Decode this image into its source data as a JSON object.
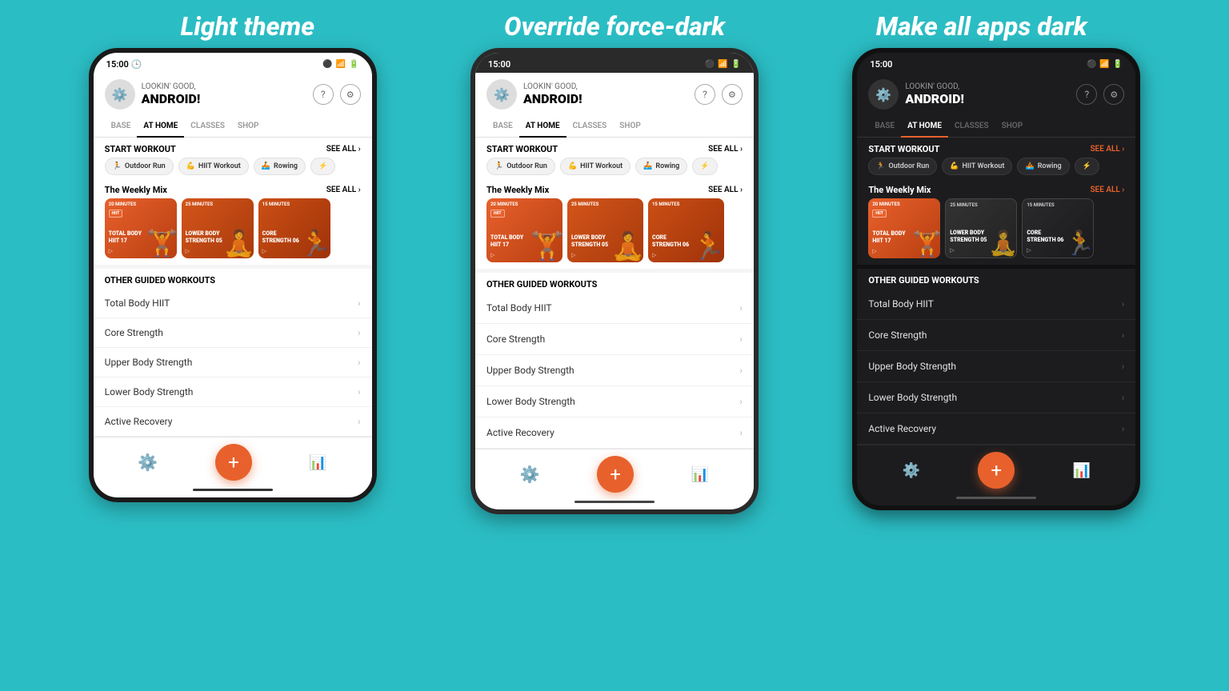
{
  "page": {
    "bg_color": "#2bbdc4",
    "headings": [
      {
        "label": "Light theme",
        "color": "#fff"
      },
      {
        "label": "Override force-dark",
        "color": "#fff"
      },
      {
        "label": "Make all apps dark",
        "color": "#fff"
      }
    ]
  },
  "phones": [
    {
      "theme": "light",
      "status": {
        "time": "15:00",
        "icons": "📶 🔋"
      },
      "greeting": "LOOKIN' GOOD,",
      "name": "ANDROID!",
      "nav": {
        "tabs": [
          "BASE",
          "AT HOME",
          "CLASSES",
          "SHOP"
        ],
        "active": "AT HOME"
      },
      "start_workout": {
        "title": "START WORKOUT",
        "see_all": "SEE ALL",
        "chips": [
          {
            "icon": "🏃",
            "label": "Outdoor Run"
          },
          {
            "icon": "💪",
            "label": "HIIT Workout"
          },
          {
            "icon": "🚣",
            "label": "Rowing"
          }
        ]
      },
      "weekly_mix": {
        "title": "The Weekly Mix",
        "see_all": "SEE ALL",
        "cards": [
          {
            "duration": "20 MINUTES",
            "badge": "HIIT",
            "title": "TOTAL BODY\nHIIT 17",
            "color": "#e8612c"
          },
          {
            "duration": "25 MINUTES",
            "badge": "",
            "title": "LOWER BODY\nSTRENGTH 05",
            "color": "#c44b1e"
          },
          {
            "duration": "15 MINUTES",
            "badge": "",
            "title": "CORE\nSTRENGTH 06",
            "color": "#d4551a"
          }
        ]
      },
      "guided_workouts": {
        "title": "OTHER GUIDED WORKOUTS",
        "items": [
          "Total Body HIIT",
          "Core Strength",
          "Upper Body Strength",
          "Lower Body Strength",
          "Active Recovery"
        ]
      }
    },
    {
      "theme": "dark",
      "status": {
        "time": "15:00",
        "icons": "📶 🔋"
      },
      "greeting": "LOOKIN' GOOD,",
      "name": "ANDROID!",
      "nav": {
        "tabs": [
          "BASE",
          "AT HOME",
          "CLASSES",
          "SHOP"
        ],
        "active": "AT HOME"
      },
      "start_workout": {
        "title": "START WORKOUT",
        "see_all": "SEE ALL",
        "chips": [
          {
            "icon": "🏃",
            "label": "Outdoor Run"
          },
          {
            "icon": "💪",
            "label": "HIIT Workout"
          },
          {
            "icon": "🚣",
            "label": "Rowing"
          }
        ]
      },
      "weekly_mix": {
        "title": "The Weekly Mix",
        "see_all": "SEE ALL",
        "cards": [
          {
            "duration": "20 MINUTES",
            "badge": "HIIT",
            "title": "TOTAL BODY\nHIIT 17",
            "color": "#e8612c"
          },
          {
            "duration": "25 MINUTES",
            "badge": "",
            "title": "LOWER BODY\nSTRENGTH 05",
            "color": "#c44b1e"
          },
          {
            "duration": "15 MINUTES",
            "badge": "",
            "title": "CORE\nSTRENGTH 06",
            "color": "#d4551a"
          }
        ]
      },
      "guided_workouts": {
        "title": "OTHER GUIDED WORKOUTS",
        "items": [
          "Total Body HIIT",
          "Core Strength",
          "Upper Body Strength",
          "Lower Body Strength",
          "Active Recovery"
        ]
      }
    },
    {
      "theme": "vdark",
      "status": {
        "time": "15:00",
        "icons": "📶 🔋"
      },
      "greeting": "LOOKIN' GOOD,",
      "name": "ANDROID!",
      "nav": {
        "tabs": [
          "BASE",
          "AT HOME",
          "CLASSES",
          "SHOP"
        ],
        "active": "AT HOME"
      },
      "start_workout": {
        "title": "START WORKOUT",
        "see_all": "SEE ALL",
        "chips": [
          {
            "icon": "🏃",
            "label": "Outdoor Run"
          },
          {
            "icon": "💪",
            "label": "HIIT Workout"
          },
          {
            "icon": "🚣",
            "label": "Rowing"
          }
        ]
      },
      "weekly_mix": {
        "title": "The Weekly Mix",
        "see_all": "SEE ALL",
        "cards": [
          {
            "duration": "20 MINUTES",
            "badge": "HIIT",
            "title": "TOTAL BODY\nHIIT 17",
            "color": "#e8612c"
          },
          {
            "duration": "25 MINUTES",
            "badge": "",
            "title": "LOWER BODY\nSTRENGTH 05",
            "color": "#c44b1e"
          },
          {
            "duration": "15 MINUTES",
            "badge": "",
            "title": "CORE\nSTRENGTH 06",
            "color": "#d4551a"
          }
        ]
      },
      "guided_workouts": {
        "title": "OTHER GUIDED WORKOUTS",
        "items": [
          "Total Body HIIT",
          "Core Strength",
          "Upper Body Strength",
          "Lower Body Strength",
          "Active Recovery"
        ]
      }
    }
  ]
}
